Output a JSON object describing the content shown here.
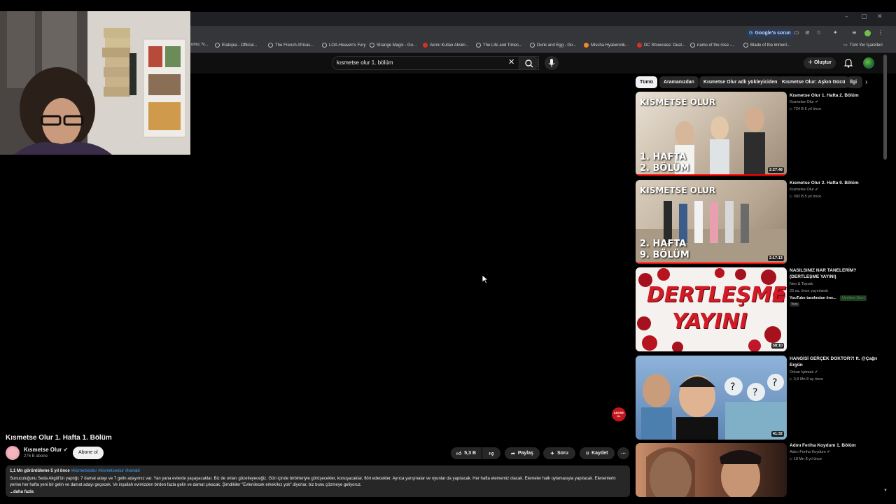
{
  "browser": {
    "window_controls": [
      "–",
      "▢",
      "✕"
    ],
    "google_problem_label": "Google'a sorun",
    "bookmarks": [
      {
        "label": "omu: N..."
      },
      {
        "label": "Elatopia - Official..."
      },
      {
        "label": "The French Africas..."
      },
      {
        "label": "LOA-Heaven's Fury"
      },
      {
        "label": "Strange Magic - Go..."
      },
      {
        "label": "Aklını Kullan Aksini..."
      },
      {
        "label": "The Life and Times..."
      },
      {
        "label": "Dunk and Egg - Go..."
      },
      {
        "label": "Missha Hyaluronik..."
      },
      {
        "label": "DC Showcase: Deat..."
      },
      {
        "label": "name of the rose -..."
      },
      {
        "label": "Blade of the immort..."
      }
    ],
    "all_bookmarks_label": "Tüm Yer İşaretleri"
  },
  "header": {
    "search_value": "kısmetse olur 1. bölüm",
    "create_label": "Oluştur"
  },
  "video": {
    "title": "Kısmetse Olur 1. Hafta 1. Bölüm",
    "channel": "Kısmetse Olur",
    "subscribers": "276 B abone",
    "subscribe_label": "Abone ol",
    "likes": "5,3 B",
    "share_label": "Paylaş",
    "ask_label": "Soru",
    "save_label": "Kaydet",
    "logo_text": "ABONE OL",
    "views_time": "1,1 Mn görüntüleme  5 yıl önce",
    "tags": "#kismetseolur #kismetseolur #kanald",
    "description": "Sunuculuğunu Seda Akgül'ün yaptığı; 7 damat adayı ve 7 gelin adayımız var. Yan yana evlerde yaşayacaklar. Biz de onları gözetleyeceğiz. Gün içinde birbirleriyle görüşecekler, konuşacaklar, flört edecekler. Ayrıca yarışmalar ve oyunlar da yapılacak. Her hafta elememiz olacak. Elemeler halk oylamasıyla yapılacak. Elenenlerin yerine her hafta yeni bir gelin ve damat adayı geçecek. Ve inşallah evimizden birden fazla gelin ve damat çıkacak. Şimdikiler \"Evlenilecek erkek/kız yok\" diyorlar, biz bunu çözmeye geliyoruz.",
    "more_label": "...daha fazla"
  },
  "chips": [
    "Tümü",
    "Aramanızdan",
    "Kısmetse Olur adlı yükleyiciden",
    "Kısmetse Olur: Aşkın Gücü",
    "İlgi"
  ],
  "recommendations": [
    {
      "title": "Kısmetse Olur 1. Hafta 2. Bölüm",
      "channel": "Kısmetse Olur",
      "stats": "724 B  5 yıl önce",
      "duration": "2:27:48",
      "thumb_top": "KISMETSE OLUR",
      "thumb_line1": "1. HAFTA",
      "thumb_line2": "2. BÖLÜM"
    },
    {
      "title": "Kısmetse Olur 2. Hafta 9. Bölüm",
      "channel": "Kısmetse Olur",
      "stats": "392 B  5 yıl önce",
      "duration": "2:17:13",
      "thumb_top": "KISMETSE OLUR",
      "thumb_line1": "2. HAFTA",
      "thumb_line2": "9. BÖLÜM"
    },
    {
      "title": "NASILSINIZ NAR TANELERİM? (DERTLEŞME YAYINI)",
      "channel": "Neo & Toprak",
      "stats": "23 sa. önce yayınlandı",
      "extra": "YouTube tarafından öne...",
      "badge": "Üyelere Özel",
      "new": "Yeni",
      "duration": "58:10",
      "thumb_line1": "DERTLEŞME",
      "thumb_line2": "YAYINI"
    },
    {
      "title": "HANGİSİ GERÇEK DOKTOR?! ft. @Çağrı Ergün",
      "channel": "Orkun Işıtmak",
      "stats": "3,9 Mn  8 ay önce",
      "duration": "41:32"
    },
    {
      "title": "Adını Feriha Koydum 1. Bölüm",
      "channel": "Adını Feriha Koydum",
      "stats": "18 Mn  8 yıl önce"
    }
  ]
}
